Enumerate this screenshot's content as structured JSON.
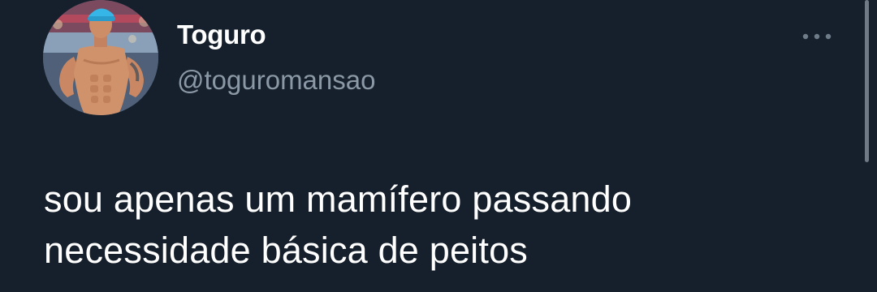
{
  "tweet": {
    "author": {
      "display_name": "Toguro",
      "handle": "@toguromansao",
      "avatar_icon": "avatar-photo"
    },
    "more_icon": "more-options-icon",
    "text_lines": [
      "sou apenas um mamífero passando",
      "necessidade básica de peitos"
    ]
  },
  "colors": {
    "background": "#16202c",
    "primary_text": "#ffffff",
    "secondary_text": "#8b98a5",
    "avatar_cap": "#35b6e6",
    "skin": "#c98863"
  }
}
